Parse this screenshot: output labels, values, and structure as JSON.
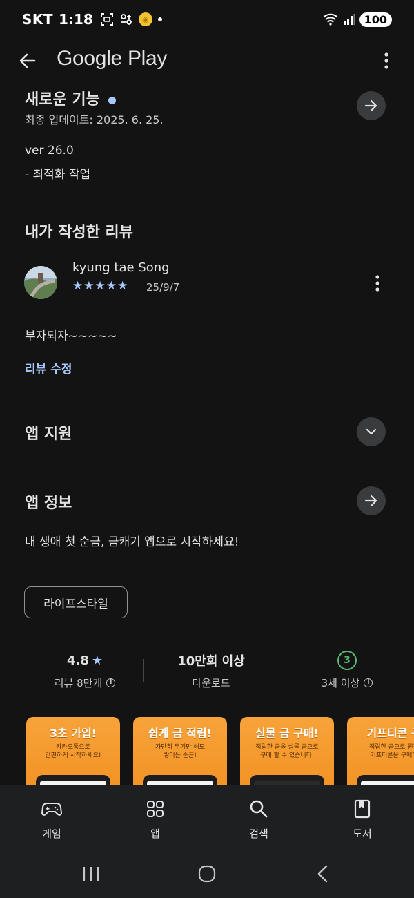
{
  "status_bar": {
    "carrier": "SKT",
    "time": "1:18",
    "battery": "100"
  },
  "app_bar": {
    "title": "Google Play"
  },
  "whats_new": {
    "title": "새로운 기능",
    "last_updated": "최종 업데이트: 2025. 6. 25.",
    "version": "ver 26.0",
    "note": "- 최적화 작업"
  },
  "my_review": {
    "section_title": "내가 작성한 리뷰",
    "reviewer": "kyung tae Song",
    "rating": 5,
    "stars": "★★★★★",
    "date": "25/9/7",
    "body": "부자되자~~~~~",
    "edit_link": "리뷰 수정"
  },
  "app_support": {
    "title": "앱 지원"
  },
  "app_info": {
    "title": "앱 정보",
    "description": "내 생애 첫 순금, 금캐기 앱으로 시작하세요!",
    "category_chip": "라이프스타일"
  },
  "stats": {
    "rating_value": "4.8",
    "rating_label": "리뷰 8만개",
    "downloads_value": "10만회 이상",
    "downloads_label": "다운로드",
    "age_badge": "3",
    "age_label": "3세 이상"
  },
  "screenshots": [
    {
      "title": "3초 가입!",
      "sub1": "카카오톡으로",
      "sub2": "간편하게 시작하세요!"
    },
    {
      "title": "쉽게 금 적립!",
      "sub1": "가만히 두기만 해도",
      "sub2": "쌓이는 순금!"
    },
    {
      "title": "실물 금 구매!",
      "sub1": "적립한 금을 실물 금으로",
      "sub2": "구매 할 수 있습니다."
    },
    {
      "title": "기프티콘 구",
      "sub1": "적립한 금으로 원하",
      "sub2": "기프티콘을 구매하"
    }
  ],
  "bottom_nav": {
    "games": "게임",
    "apps": "앱",
    "search": "검색",
    "books": "도서"
  },
  "colors": {
    "background": "#131314",
    "accent_blue": "#a8c7fa",
    "age_green": "#5bb974",
    "screenshot_orange": "#f29022"
  }
}
